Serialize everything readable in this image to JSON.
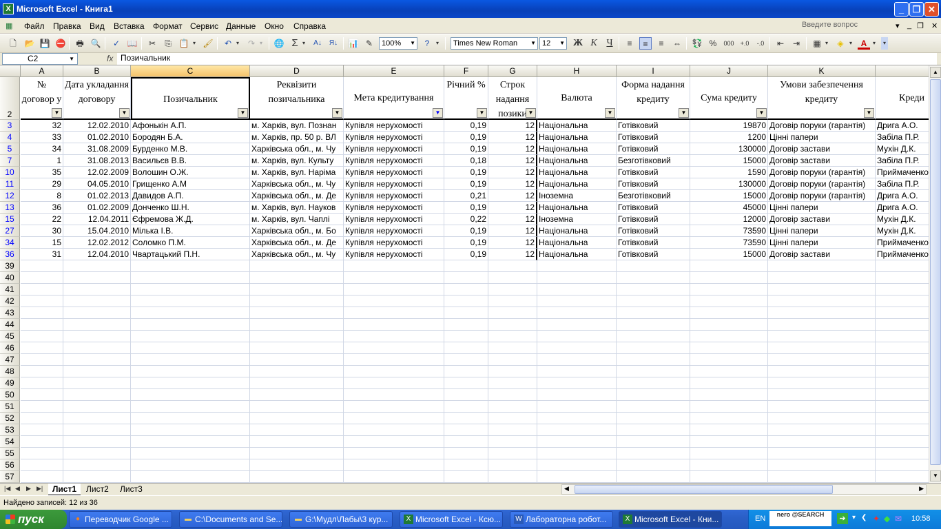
{
  "app": {
    "title": "Microsoft Excel - Книга1"
  },
  "menu": {
    "items": [
      "Файл",
      "Правка",
      "Вид",
      "Вставка",
      "Формат",
      "Сервис",
      "Данные",
      "Окно",
      "Справка"
    ],
    "help_placeholder": "Введите вопрос"
  },
  "toolbar": {
    "zoom": "100%",
    "font": "Times New Roman",
    "font_size": "12",
    "bold": "Ж",
    "italic": "К",
    "underline": "Ч",
    "sigma": "Σ",
    "percent": "%",
    "thousands": "000",
    "font_color_letter": "A"
  },
  "formula": {
    "cell_ref": "C2",
    "fx": "fx",
    "content": "Позичальник"
  },
  "columns": [
    "A",
    "B",
    "C",
    "D",
    "E",
    "F",
    "G",
    "H",
    "I",
    "J",
    "K"
  ],
  "header_row": {
    "row_num": "2",
    "cells": [
      "№ договор у",
      "Дата укладання договору",
      "Позичальник",
      "Реквізити позичальника",
      "Мета кредитування",
      "Річний %",
      "Строк надання позики",
      "Валюта",
      "Форма надання кредиту",
      "Сума кредиту",
      "Умови забезпечення кредиту",
      "Креди"
    ]
  },
  "rows": [
    {
      "n": "3",
      "a": "32",
      "b": "12.02.2010",
      "c": "Афонькін А.П.",
      "d": "м. Харків, вул. Познан",
      "e": "Купівля нерухомості",
      "f": "0,19",
      "g": "12",
      "h": "Національна",
      "i": "Готівковий",
      "j": "19870",
      "k": "Договір поруки (гарантія)",
      "l": "Дрига А.О."
    },
    {
      "n": "4",
      "a": "33",
      "b": "01.02.2010",
      "c": "Бородян Б.А.",
      "d": "м. Харків, пр. 50 р. ВЛ",
      "e": "Купівля нерухомості",
      "f": "0,19",
      "g": "12",
      "h": "Національна",
      "i": "Готівковий",
      "j": "1200",
      "k": "Цінні папери",
      "l": "Забіла П.Р."
    },
    {
      "n": "5",
      "a": "34",
      "b": "31.08.2009",
      "c": "Бурденко М.В.",
      "d": "Харківська обл., м. Чу",
      "e": "Купівля нерухомості",
      "f": "0,19",
      "g": "12",
      "h": "Національна",
      "i": "Готівковий",
      "j": "130000",
      "k": "Договір застави",
      "l": "Мухін Д.К."
    },
    {
      "n": "7",
      "a": "1",
      "b": "31.08.2013",
      "c": "Васильєв В.В.",
      "d": "м. Харків, вул. Культу",
      "e": "Купівля нерухомості",
      "f": "0,18",
      "g": "12",
      "h": "Національна",
      "i": "Безготівковий",
      "j": "15000",
      "k": "Договір застави",
      "l": "Забіла П.Р."
    },
    {
      "n": "10",
      "a": "35",
      "b": "12.02.2009",
      "c": "Волошин О.Ж.",
      "d": "м. Харків, вул. Наріма",
      "e": "Купівля нерухомості",
      "f": "0,19",
      "g": "12",
      "h": "Національна",
      "i": "Готівковий",
      "j": "1590",
      "k": "Договір поруки (гарантія)",
      "l": "Приймаченко"
    },
    {
      "n": "11",
      "a": "29",
      "b": "04.05.2010",
      "c": "Грищенко А.М",
      "d": "Харківська обл., м. Чу",
      "e": "Купівля нерухомості",
      "f": "0,19",
      "g": "12",
      "h": "Національна",
      "i": "Готівковий",
      "j": "130000",
      "k": "Договір поруки (гарантія)",
      "l": "Забіла П.Р."
    },
    {
      "n": "12",
      "a": "8",
      "b": "01.02.2013",
      "c": "Давидов А.П.",
      "d": "Харківська обл., м. Де",
      "e": "Купівля нерухомості",
      "f": "0,21",
      "g": "12",
      "h": "Іноземна",
      "i": "Безготівковий",
      "j": "15000",
      "k": "Договір поруки (гарантія)",
      "l": "Дрига А.О."
    },
    {
      "n": "13",
      "a": "36",
      "b": "01.02.2009",
      "c": "Донченко Ш.Н.",
      "d": "м. Харків, вул. Науков",
      "e": "Купівля нерухомості",
      "f": "0,19",
      "g": "12",
      "h": "Національна",
      "i": "Готівковий",
      "j": "45000",
      "k": "Цінні папери",
      "l": "Дрига А.О."
    },
    {
      "n": "15",
      "a": "22",
      "b": "12.04.2011",
      "c": "Єфремова Ж.Д.",
      "d": "м. Харків, вул. Чаплі",
      "e": "Купівля нерухомості",
      "f": "0,22",
      "g": "12",
      "h": "Іноземна",
      "i": "Готівковий",
      "j": "12000",
      "k": "Договір застави",
      "l": "Мухін Д.К."
    },
    {
      "n": "27",
      "a": "30",
      "b": "15.04.2010",
      "c": "Мілька І.В.",
      "d": "Харківська обл., м. Бо",
      "e": "Купівля нерухомості",
      "f": "0,19",
      "g": "12",
      "h": "Національна",
      "i": "Готівковий",
      "j": "73590",
      "k": "Цінні папери",
      "l": "Мухін Д.К."
    },
    {
      "n": "34",
      "a": "15",
      "b": "12.02.2012",
      "c": "Соломко П.М.",
      "d": "Харківська обл., м. Де",
      "e": "Купівля нерухомості",
      "f": "0,19",
      "g": "12",
      "h": "Національна",
      "i": "Готівковий",
      "j": "73590",
      "k": "Цінні папери",
      "l": "Приймаченко"
    },
    {
      "n": "36",
      "a": "31",
      "b": "12.04.2010",
      "c": "Чвартацький П.Н.",
      "d": "Харківська обл., м. Чу",
      "e": "Купівля нерухомості",
      "f": "0,19",
      "g": "12",
      "h": "Національна",
      "i": "Готівковий",
      "j": "15000",
      "k": "Договір застави",
      "l": "Приймаченко"
    }
  ],
  "empty_rows": [
    "39",
    "40",
    "41",
    "42",
    "43",
    "44",
    "45",
    "46",
    "47",
    "48",
    "49",
    "50",
    "51",
    "52",
    "53",
    "54",
    "55",
    "56",
    "57"
  ],
  "sheets": [
    "Лист1",
    "Лист2",
    "Лист3"
  ],
  "status": "Найдено записей: 12 из 36",
  "taskbar": {
    "start": "пуск",
    "tasks": [
      "Переводчик Google ...",
      "C:\\Documents and Se...",
      "G:\\Мудл\\Лабы\\3 кур...",
      "Microsoft Excel - Ксю...",
      "Лабораторна робот...",
      "Microsoft Excel - Кни..."
    ],
    "lang": "EN",
    "nero": "nero @SEARCH",
    "clock": "10:58"
  }
}
